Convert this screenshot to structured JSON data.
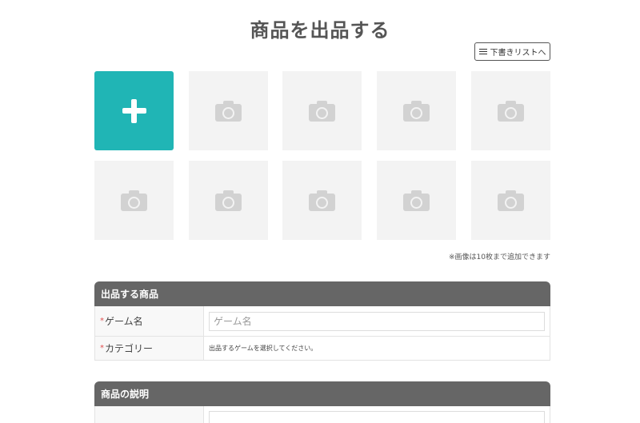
{
  "page": {
    "title": "商品を出品する"
  },
  "draft_button": {
    "label": "下書きリストへ",
    "icon": "list-icon"
  },
  "photos": {
    "add_icon": "plus-icon",
    "placeholder_icon": "camera-icon",
    "slots": 10,
    "note": "※画像は10枚まで追加できます"
  },
  "product_section": {
    "title": "出品する商品",
    "rows": [
      {
        "required_mark": "*",
        "label": "ゲーム名",
        "placeholder": "ゲーム名"
      },
      {
        "required_mark": "*",
        "label": "カテゴリー",
        "hint": "出品するゲームを選択してください。"
      }
    ]
  },
  "description_section": {
    "title": "商品の説明"
  },
  "colors": {
    "accent": "#20b5b5",
    "section_header": "#666666",
    "required": "#e05050"
  }
}
